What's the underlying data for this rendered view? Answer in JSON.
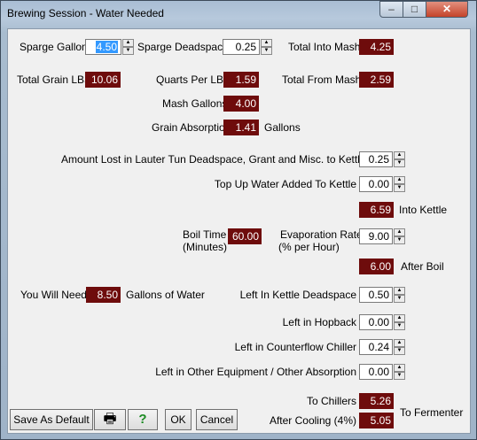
{
  "window": {
    "title": "Brewing Session - Water Needed"
  },
  "titlebar": {
    "minimize": "–",
    "maximize": "□",
    "close": "✕"
  },
  "inputs": {
    "sparge_gallons": {
      "label": "Sparge Gallons",
      "value": "4.50"
    },
    "sparge_deadspace": {
      "label": "Sparge Deadspace",
      "value": "0.25"
    },
    "lauter_loss": {
      "label": "Amount Lost in Lauter Tun Deadspace, Grant and Misc. to Kettle",
      "value": "0.25"
    },
    "top_up": {
      "label": "Top Up Water Added To Kettle",
      "value": "0.00"
    },
    "evaporation": {
      "label_line1": "Evaporation Rate",
      "label_line2": "(% per Hour)",
      "value": "9.00"
    },
    "kettle_deadspace": {
      "label": "Left In Kettle Deadspace",
      "value": "0.50"
    },
    "hopback": {
      "label": "Left in Hopback",
      "value": "0.00"
    },
    "counterflow": {
      "label": "Left in Counterflow Chiller",
      "value": "0.24"
    },
    "other_equipment": {
      "label": "Left in Other Equipment / Other Absorption",
      "value": "0.00"
    }
  },
  "outputs": {
    "total_into_mash": {
      "label": "Total Into Mash",
      "value": "4.25"
    },
    "total_grain": {
      "label": "Total Grain LBS",
      "value": "10.06"
    },
    "quarts_per_lbs": {
      "label": "Quarts Per LBS",
      "value": "1.59"
    },
    "total_from_mash": {
      "label": "Total  From Mash",
      "value": "2.59"
    },
    "mash_gallons": {
      "label": "Mash Gallons",
      "value": "4.00"
    },
    "grain_absorption": {
      "label": "Grain Absorption",
      "value": "1.41",
      "unit": "Gallons"
    },
    "into_kettle": {
      "label": "Into Kettle",
      "value": "6.59"
    },
    "boil_time": {
      "label_line1": "Boil Time",
      "label_line2": "(Minutes)",
      "value": "60.00"
    },
    "after_boil": {
      "label": "After Boil",
      "value": "6.00"
    },
    "you_will_need": {
      "label": "You Will Need",
      "value": "8.50",
      "unit": "Gallons of Water"
    },
    "to_chillers": {
      "label": "To Chillers",
      "value": "5.26"
    },
    "after_cooling": {
      "label": "After Cooling (4%)",
      "value": "5.05"
    },
    "to_fermenter": {
      "label": "To Fermenter"
    }
  },
  "buttons": {
    "save_default": "Save As Default",
    "print_icon": "🖶",
    "help": "?",
    "ok": "OK",
    "cancel": "Cancel"
  },
  "icons": {
    "spin_up": "▲",
    "spin_down": "▼"
  },
  "colors": {
    "value_box": "#6e0c0c",
    "selection": "#3399ff",
    "help": "#1b8b22"
  }
}
